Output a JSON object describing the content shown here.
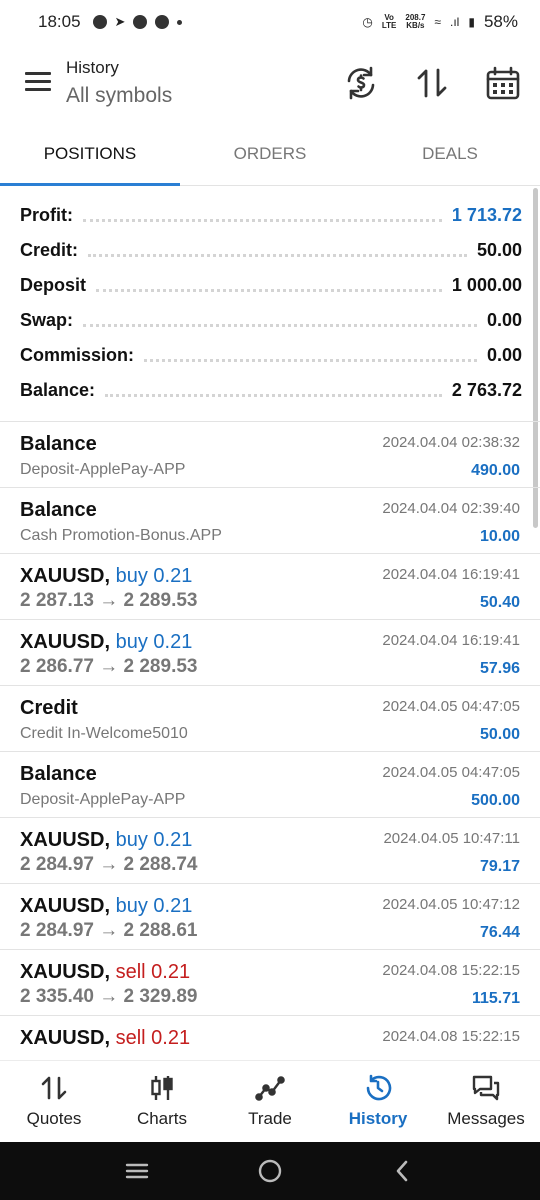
{
  "status_bar": {
    "time": "18:05",
    "net_speed_value": "208.7",
    "net_speed_unit": "KB/s",
    "network": "LTE",
    "battery": "58%"
  },
  "header": {
    "title": "History",
    "subtitle": "All symbols"
  },
  "tabs": [
    {
      "label": "POSITIONS",
      "active": true
    },
    {
      "label": "ORDERS",
      "active": false
    },
    {
      "label": "DEALS",
      "active": false
    }
  ],
  "summary": {
    "profit": {
      "label": "Profit:",
      "value": "1 713.72"
    },
    "credit": {
      "label": "Credit:",
      "value": "50.00"
    },
    "deposit": {
      "label": "Deposit",
      "value": "1 000.00"
    },
    "swap": {
      "label": "Swap:",
      "value": "0.00"
    },
    "commission": {
      "label": "Commission:",
      "value": "0.00"
    },
    "balance": {
      "label": "Balance:",
      "value": "2 763.72"
    }
  },
  "history": [
    {
      "title": "Balance",
      "side": "",
      "volume": "",
      "subtitle": "Deposit-ApplePay-APP",
      "date": "2024.04.04 02:38:32",
      "amount": "490.00"
    },
    {
      "title": "Balance",
      "side": "",
      "volume": "",
      "subtitle": "Cash Promotion-Bonus.APP",
      "date": "2024.04.04 02:39:40",
      "amount": "10.00"
    },
    {
      "title": "XAUUSD,",
      "side": "buy",
      "volume": "0.21",
      "subtitle": "2 287.13 → 2 289.53",
      "date": "2024.04.04 16:19:41",
      "amount": "50.40"
    },
    {
      "title": "XAUUSD,",
      "side": "buy",
      "volume": "0.21",
      "subtitle": "2 286.77 → 2 289.53",
      "date": "2024.04.04 16:19:41",
      "amount": "57.96"
    },
    {
      "title": "Credit",
      "side": "",
      "volume": "",
      "subtitle": "Credit In-Welcome5010",
      "date": "2024.04.05 04:47:05",
      "amount": "50.00"
    },
    {
      "title": "Balance",
      "side": "",
      "volume": "",
      "subtitle": "Deposit-ApplePay-APP",
      "date": "2024.04.05 04:47:05",
      "amount": "500.00"
    },
    {
      "title": "XAUUSD,",
      "side": "buy",
      "volume": "0.21",
      "subtitle": "2 284.97 → 2 288.74",
      "date": "2024.04.05 10:47:11",
      "amount": "79.17"
    },
    {
      "title": "XAUUSD,",
      "side": "buy",
      "volume": "0.21",
      "subtitle": "2 284.97 → 2 288.61",
      "date": "2024.04.05 10:47:12",
      "amount": "76.44"
    },
    {
      "title": "XAUUSD,",
      "side": "sell",
      "volume": "0.21",
      "subtitle": "2 335.40 → 2 329.89",
      "date": "2024.04.08 15:22:15",
      "amount": "115.71"
    },
    {
      "title": "XAUUSD,",
      "side": "sell",
      "volume": "0.21",
      "subtitle": "",
      "date": "2024.04.08 15:22:15",
      "amount": ""
    }
  ],
  "bottom_nav": [
    {
      "label": "Quotes",
      "icon": "quotes-icon",
      "active": false
    },
    {
      "label": "Charts",
      "icon": "charts-icon",
      "active": false
    },
    {
      "label": "Trade",
      "icon": "trade-icon",
      "active": false
    },
    {
      "label": "History",
      "icon": "history-icon",
      "active": true
    },
    {
      "label": "Messages",
      "icon": "messages-icon",
      "active": false
    }
  ],
  "colors": {
    "accent": "#1a6fc2",
    "sell": "#c41e1e",
    "tab_indicator": "#2a7fd4"
  }
}
